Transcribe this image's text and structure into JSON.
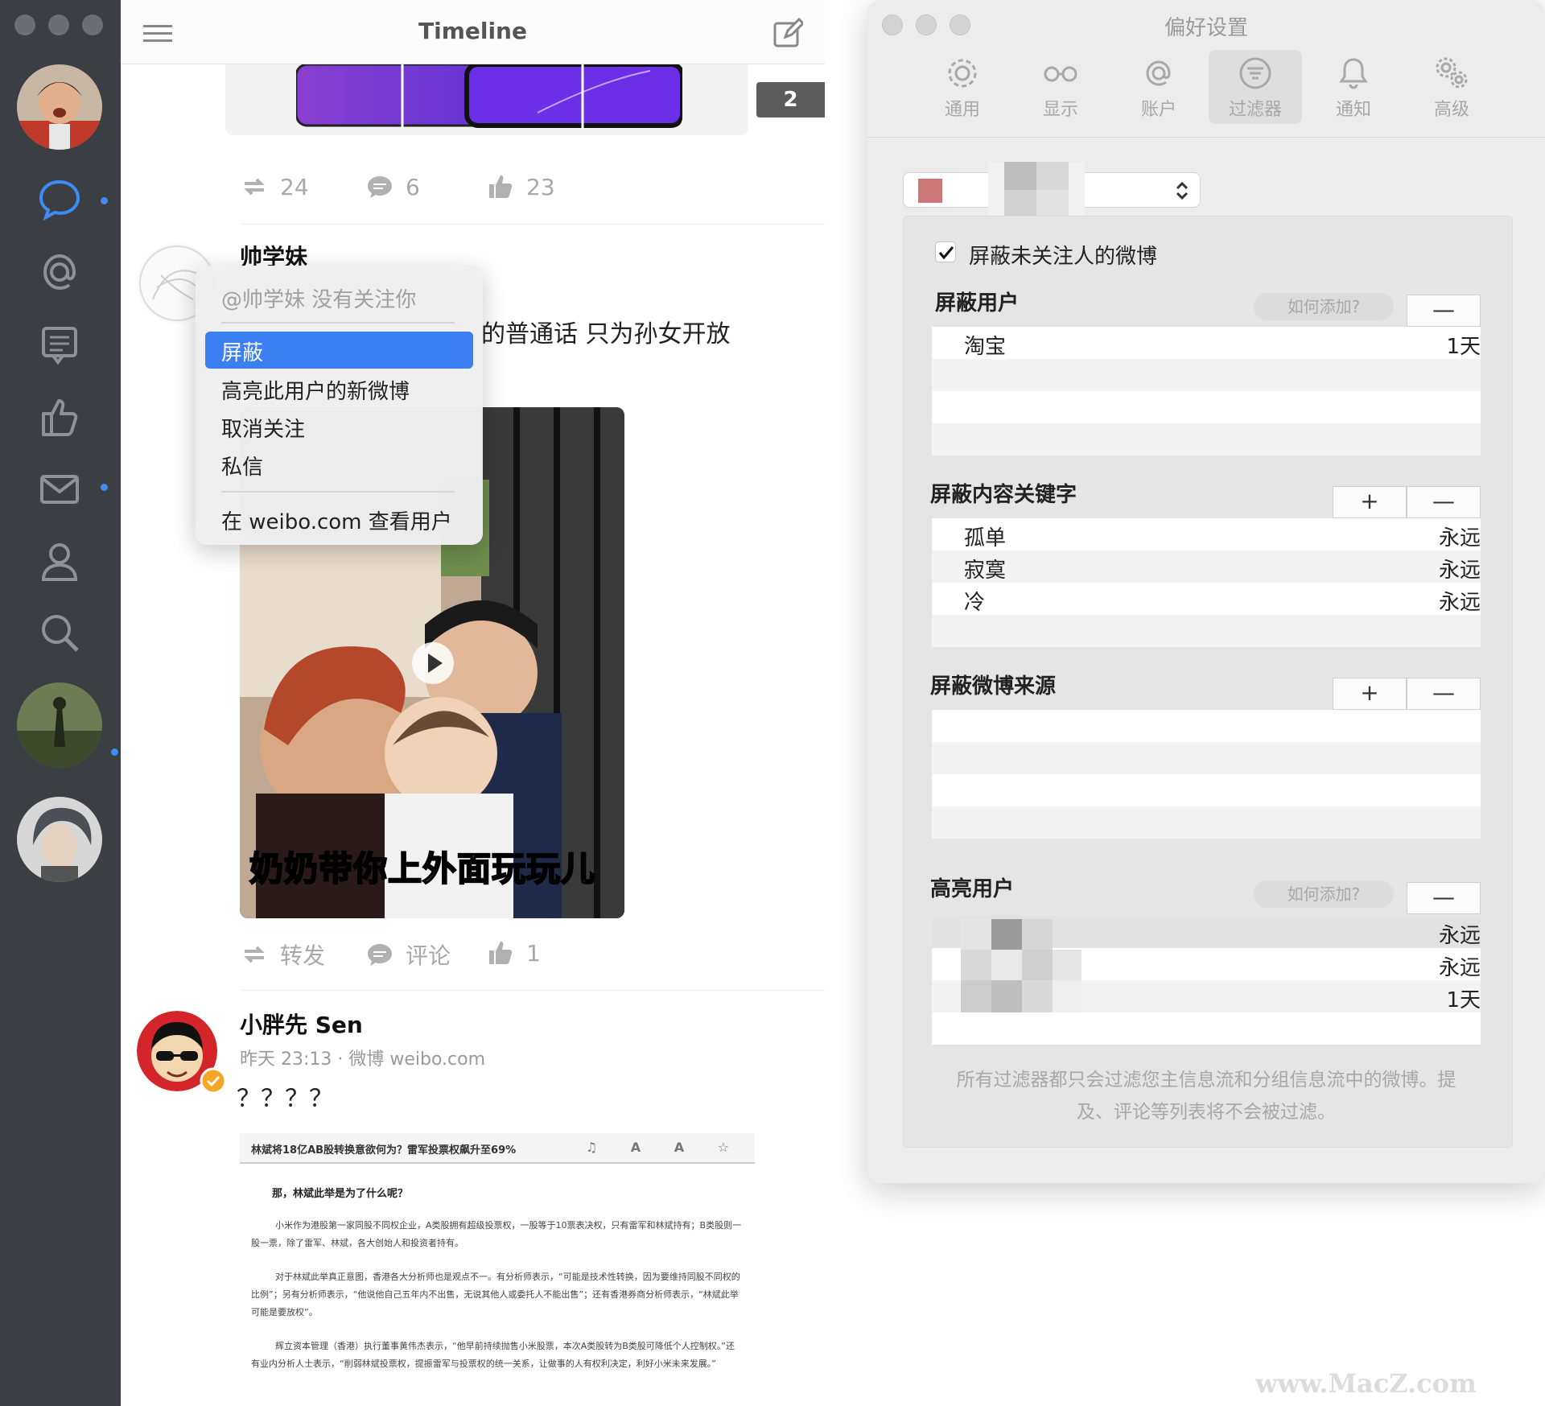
{
  "timeline": {
    "title": "Timeline",
    "unread_badge": "2",
    "post1_actions": {
      "reposts": "24",
      "comments": "6",
      "likes": "23"
    },
    "post2": {
      "author": "帅学妹",
      "text_visible": "的普通话 只为孙女开放",
      "video_caption": "奶奶带你上外面玩玩儿",
      "actions": {
        "repost": "转发",
        "comment": "评论",
        "likes": "1"
      }
    },
    "post3": {
      "author": "小胖先 Sen",
      "meta": "昨天 23:13 · 微博 weibo.com",
      "text": "？？？？",
      "article": {
        "bar_title": "林斌将18亿AB股转换意欲何为？雷军投票权飙升至69%",
        "heading": "那，林斌此举是为了什么呢？",
        "paragraphs": [
          "小米作为港股第一家同股不同权企业，A类股拥有超级投票权，一股等于10票表决权，只有雷军和林斌持有；B类股则一股一票，除了雷军、林斌，各大创始人和投资者持有。",
          "对于林斌此举真正意图，香港各大分析师也是观点不一。有分析师表示，“可能是技术性转换，因为要维持同股不同权的比例”；另有分析师表示，“他说他自己五年内不出售，无说其他人或委托人不能出售”；还有香港券商分析师表示，“林斌此举可能是要放权”。",
          "辉立资本管理（香港）执行董事黄伟杰表示，“他早前持续抛售小米股票，本次A类股转为B类股可降低个人控制权。”还有业内分析人士表示，“削弱林斌投票权，提振雷军与投票权的统一关系，让做事的人有权利决定，利好小米未来发展。”"
        ]
      }
    }
  },
  "context_menu": {
    "header": "@帅学妹 没有关注你",
    "items": [
      "屏蔽",
      "高亮此用户的新微博",
      "取消关注",
      "私信"
    ],
    "view_on_web": "在 weibo.com 查看用户"
  },
  "prefs": {
    "title": "偏好设置",
    "tabs": [
      "通用",
      "显示",
      "账户",
      "过滤器",
      "通知",
      "高级"
    ],
    "active_tab": "过滤器",
    "hide_unfollowed_label": "屏蔽未关注人的微博",
    "blocked_users": {
      "title": "屏蔽用户",
      "help": "如何添加?",
      "minus": "—",
      "rows": [
        {
          "name": "淘宝",
          "duration": "1天"
        }
      ]
    },
    "blocked_keywords": {
      "title": "屏蔽内容关键字",
      "plus": "+",
      "minus": "—",
      "rows": [
        {
          "name": "孤单",
          "duration": "永远"
        },
        {
          "name": "寂寞",
          "duration": "永远"
        },
        {
          "name": "冷",
          "duration": "永远"
        }
      ]
    },
    "blocked_sources": {
      "title": "屏蔽微博来源",
      "plus": "+",
      "minus": "—"
    },
    "highlight_users": {
      "title": "高亮用户",
      "help": "如何添加?",
      "minus": "—",
      "rows": [
        {
          "duration": "永远"
        },
        {
          "duration": "永远"
        },
        {
          "duration": "1天"
        }
      ]
    },
    "footnote": "所有过滤器都只会过滤您主信息流和分组信息流中的微博。提及、评论等列表将不会被过滤。"
  },
  "watermark": "www.MacZ.com",
  "colors": {
    "accent": "#3b7ff2",
    "sidebar": "#3b3e43",
    "nav_active": "#3c8cf3"
  }
}
